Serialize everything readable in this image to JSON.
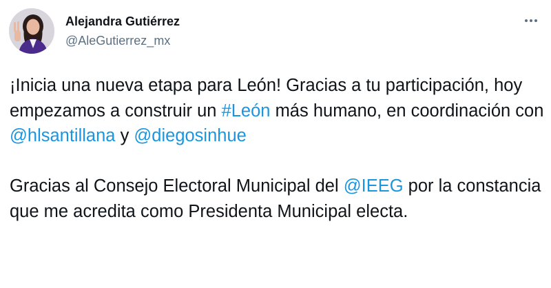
{
  "tweet": {
    "author": {
      "display_name": "Alejandra Gutiérrez",
      "handle": "@AleGutierrez_mx",
      "avatar_icon": "profile-photo"
    },
    "more_icon": "more-horizontal-icon",
    "paragraph1": {
      "part1": "¡Inicia una nueva etapa para León!  Gracias a tu participación, hoy empezamos a construir un ",
      "hashtag": "#León",
      "part2": " más humano, en coordinación con ",
      "mention1": "@hlsantillana",
      "part3": " y ",
      "mention2": "@diegosinhue"
    },
    "paragraph2": {
      "part1": "Gracias al Consejo Electoral Municipal del ",
      "mention": "@IEEG",
      "part2": " por la constancia que me acredita como Presidenta Municipal electa."
    }
  },
  "colors": {
    "text": "#0f1419",
    "secondary": "#5b7083",
    "link": "#1b95e0",
    "background": "#ffffff"
  }
}
